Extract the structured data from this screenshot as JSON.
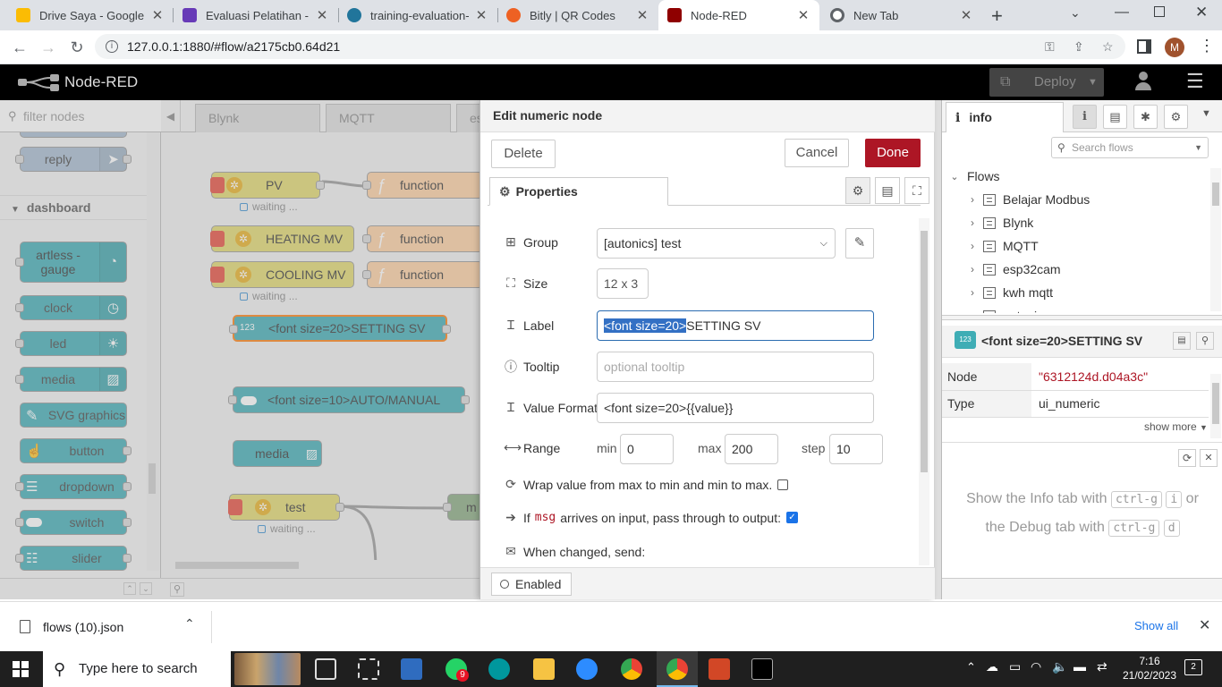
{
  "browser": {
    "tabs": [
      {
        "title": "Drive Saya - Google D",
        "icon": "google-drive-icon",
        "color": "#fbbc04"
      },
      {
        "title": "Evaluasi Pelatihan - Go",
        "icon": "google-forms-icon",
        "color": "#673ab7"
      },
      {
        "title": "training-evaluation-fo",
        "icon": "wordpress-icon",
        "color": "#21759b"
      },
      {
        "title": "Bitly | QR Codes",
        "icon": "bitly-icon",
        "color": "#ee6123"
      },
      {
        "title": "Node-RED",
        "icon": "node-red-icon",
        "color": "#8f0000"
      },
      {
        "title": "New Tab",
        "icon": "chrome-icon",
        "color": "#5f6368"
      }
    ],
    "active_tab_index": 4,
    "url": "127.0.0.1:1880/#flow/a2175cb0.64d21",
    "profile_initial": "M"
  },
  "nodered": {
    "app_title": "Node-RED",
    "deploy_label": "Deploy",
    "palette": {
      "filter_placeholder": "filter nodes",
      "reply_label": "reply",
      "category": "dashboard",
      "nodes": [
        "artless -\ngauge",
        "clock",
        "led",
        "media",
        "SVG graphics",
        "button",
        "dropdown",
        "switch",
        "slider"
      ]
    },
    "workspace": {
      "tabs": [
        "Blynk",
        "MQTT",
        "es"
      ],
      "nodes": {
        "pv": "PV",
        "heating": "HEATING MV",
        "cooling": "COOLING MV",
        "function": "function",
        "setting_sv": "<font size=20>SETTING SV",
        "auto_manual": "<font size=10>AUTO/MANUAL",
        "media": "media",
        "test": "test",
        "m": "m"
      },
      "waiting": "waiting ..."
    },
    "edit": {
      "title": "Edit numeric node",
      "delete": "Delete",
      "cancel": "Cancel",
      "done": "Done",
      "properties_tab": "Properties",
      "group_label": "Group",
      "group_value": "[autonics] test",
      "size_label": "Size",
      "size_value": "12 x 3",
      "label_label": "Label",
      "label_value_selected": "<font size=20>",
      "label_value_rest": "SETTING SV",
      "tooltip_label": "Tooltip",
      "tooltip_placeholder": "optional tooltip",
      "format_label": "Value Format",
      "format_value": "<font size=20>{{value}}",
      "range_label": "Range",
      "min_label": "min",
      "min_value": "0",
      "max_label": "max",
      "max_value": "200",
      "step_label": "step",
      "step_value": "10",
      "wrap_label": "Wrap value from max to min and min to max.",
      "wrap_checked": false,
      "passthru_pre": "If",
      "passthru_code": "msg",
      "passthru_post": "arrives on input, pass through to output:",
      "passthru_checked": true,
      "when_changed": "When changed, send:",
      "enabled": "Enabled"
    },
    "sidebar": {
      "tab_label": "info",
      "search_placeholder": "Search flows",
      "flows_heading": "Flows",
      "flows": [
        "Belajar Modbus",
        "Blynk",
        "MQTT",
        "esp32cam",
        "kwh mqtt",
        "autonic"
      ],
      "node_title": "<font size=20>SETTING SV",
      "node_key": "Node",
      "node_value": "\"6312124d.d04a3c\"",
      "type_key": "Type",
      "type_value": "ui_numeric",
      "show_more": "show more",
      "help_1": "Show the Info tab with",
      "help_key1": "ctrl-g",
      "help_key2": "i",
      "help_or": "or",
      "help_2": "the Debug tab with",
      "help_key3": "ctrl-g",
      "help_key4": "d"
    }
  },
  "downloads": {
    "file": "flows (10).json",
    "show_all": "Show all"
  },
  "taskbar": {
    "search_placeholder": "Type here to search",
    "time": "7:16",
    "date": "21/02/2023",
    "notifications": "2",
    "whatsapp_badge": "9"
  }
}
